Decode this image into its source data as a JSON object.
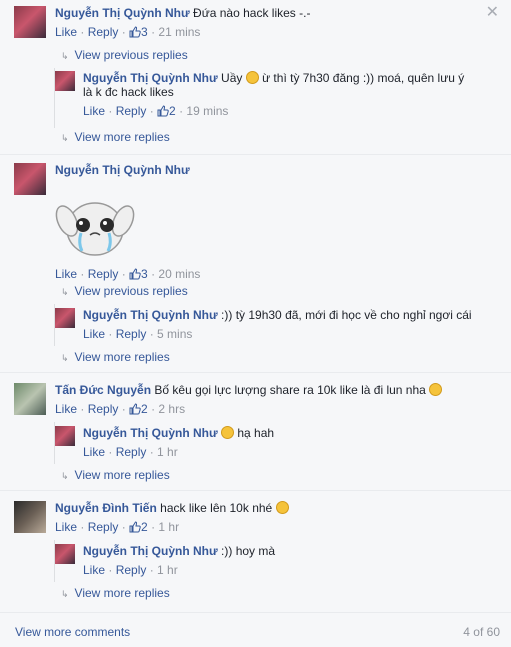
{
  "ui": {
    "like": "Like",
    "reply": "Reply"
  },
  "comments": [
    {
      "name": "Nguyễn Thị Quỳnh Như",
      "text": "Đứa nào hack likes -.-",
      "likes": "3",
      "time": "21 mins",
      "prev_replies": "View previous replies",
      "more_replies": "View more replies",
      "replies": [
        {
          "name": "Nguyễn Thị Quỳnh Như",
          "text_before": "Uầy",
          "text_after": "ừ thì tỳ 7h30 đăng :)) moá, quên lưu ý là k đc hack likes",
          "likes": "2",
          "time": "19 mins"
        }
      ]
    },
    {
      "name": "Nguyễn Thị Quỳnh Như",
      "likes": "3",
      "time": "20 mins",
      "prev_replies": "View previous replies",
      "more_replies": "View more replies",
      "replies": [
        {
          "name": "Nguyễn Thị Quỳnh Như",
          "text": ":)) tỳ 19h30 đã, mới đi học về cho nghỉ ngơi cái",
          "time": "5 mins"
        }
      ]
    },
    {
      "name": "Tấn Đức Nguyễn",
      "text": "Bố kêu gọi lực lượng share ra 10k like là đi lun nha",
      "likes": "2",
      "time": "2 hrs",
      "more_replies": "View more replies",
      "replies": [
        {
          "name": "Nguyễn Thị Quỳnh Như",
          "text": "hạ hah",
          "time": "1 hr"
        }
      ]
    },
    {
      "name": "Nguyễn Đình Tiến",
      "text": "hack like lên 10k nhé",
      "likes": "2",
      "time": "1 hr",
      "more_replies": "View more replies",
      "replies": [
        {
          "name": "Nguyễn Thị Quỳnh Như",
          "text": ":)) hoy mà",
          "time": "1 hr"
        }
      ]
    }
  ],
  "footer": {
    "more_comments": "View more comments",
    "count": "4 of 60"
  },
  "colors": {
    "link": "#365899",
    "meta": "#90949c",
    "background": "#f6f7f9"
  }
}
